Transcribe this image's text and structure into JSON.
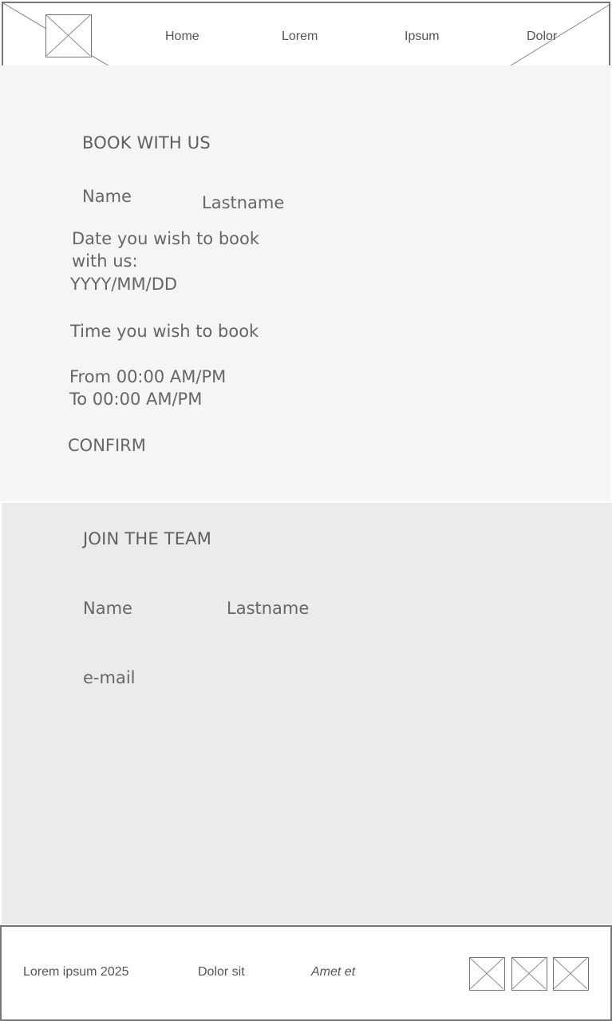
{
  "header": {
    "logo_icon": "image-placeholder-icon",
    "nav": [
      "Home",
      "Lorem",
      "Ipsum",
      "Dolor"
    ]
  },
  "booking": {
    "title": "BOOK WITH US",
    "name_label": "Name",
    "lastname_label": "Lastname",
    "date_label_line1": "Date you wish to book",
    "date_label_line2": "with us:",
    "date_placeholder": "YYYY/MM/DD",
    "time_label": "Time you wish to book",
    "from_placeholder": "From 00:00 AM/PM",
    "to_placeholder": "To 00:00 AM/PM",
    "confirm_label": "CONFIRM"
  },
  "join": {
    "title": "JOIN THE TEAM",
    "name_label": "Name",
    "lastname_label": "Lastname",
    "email_label": "e-mail"
  },
  "footer": {
    "copyright": "Lorem ipsum 2025",
    "link1": "Dolor sit",
    "link2": "Amet et",
    "icons": [
      "image-placeholder-icon",
      "image-placeholder-icon",
      "image-placeholder-icon"
    ]
  },
  "colors": {
    "booking_bg": "#f7f4f4",
    "join_bg": "#ebebeb",
    "text": "#666666",
    "border": "#777777"
  }
}
